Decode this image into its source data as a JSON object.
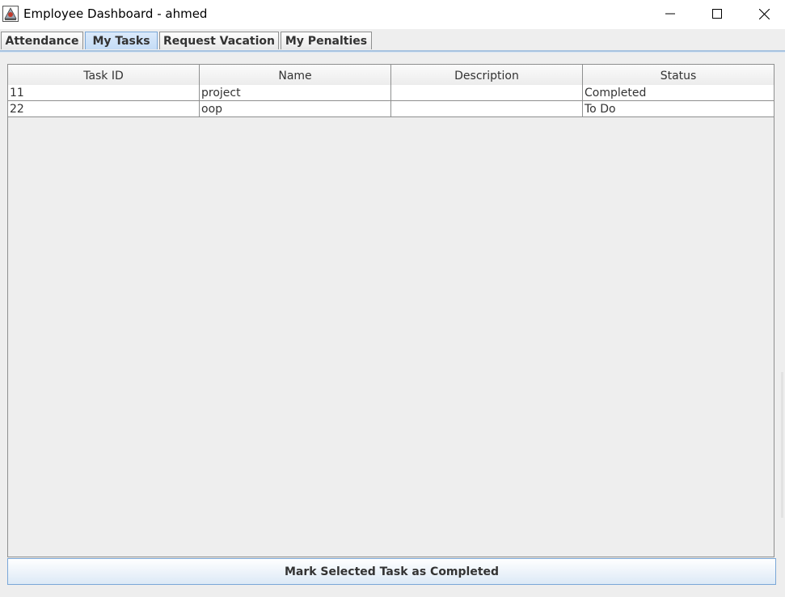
{
  "window": {
    "title": "Employee Dashboard - ahmed",
    "app_icon": "java-app-icon"
  },
  "controls": {
    "minimize_icon": "minimize-icon",
    "maximize_icon": "maximize-icon",
    "close_icon": "close-icon"
  },
  "tabs": [
    {
      "label": "Attendance",
      "selected": false
    },
    {
      "label": "My Tasks",
      "selected": true
    },
    {
      "label": "Request Vacation",
      "selected": false
    },
    {
      "label": "My Penalties",
      "selected": false
    }
  ],
  "table": {
    "columns": [
      "Task ID",
      "Name",
      "Description",
      "Status"
    ],
    "rows": [
      [
        "11",
        "project",
        "",
        "Completed"
      ],
      [
        "22",
        "oop",
        "",
        "To Do"
      ]
    ]
  },
  "actions": {
    "mark_completed_label": "Mark Selected Task as Completed"
  },
  "colors": {
    "selected_tab": "#c4dcf6",
    "window_bg": "#eeeeee",
    "border": "#8e8f8f"
  }
}
